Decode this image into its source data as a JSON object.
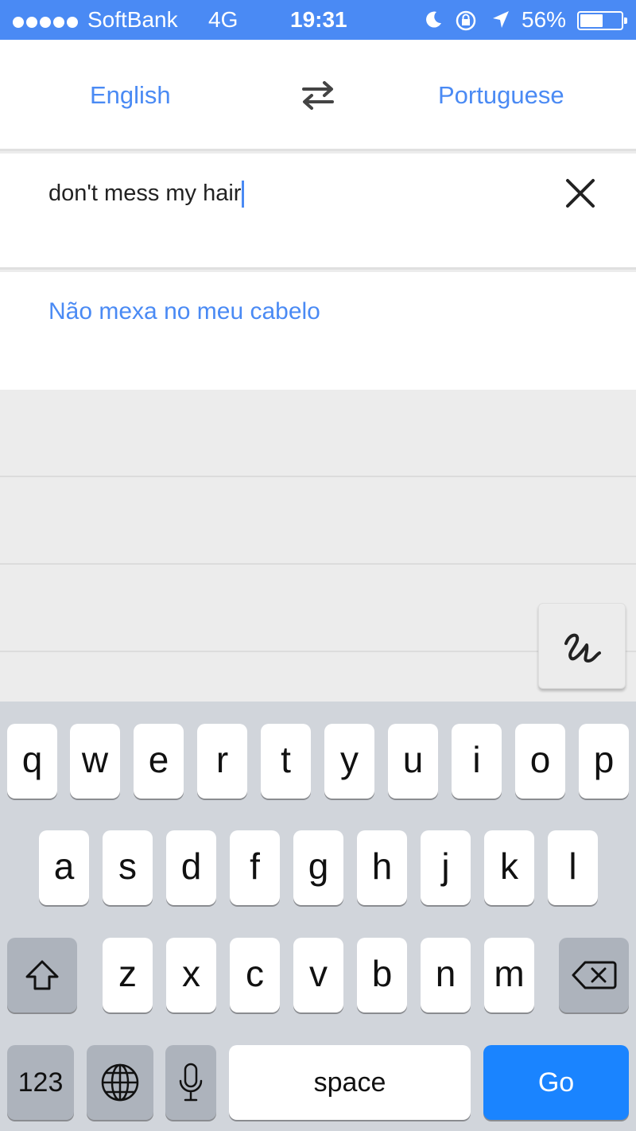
{
  "status_bar": {
    "carrier": "SoftBank",
    "network": "4G",
    "time": "19:31",
    "battery_percent": "56%",
    "battery_level": 0.56,
    "signal_dots": 5,
    "icons": [
      "moon-icon",
      "rotation-lock-icon",
      "location-arrow-icon",
      "battery-icon"
    ]
  },
  "language_bar": {
    "source_language": "English",
    "target_language": "Portuguese",
    "swap_icon": "swap-arrows-icon"
  },
  "input": {
    "text": "don't mess my hair",
    "clear_icon": "close-icon"
  },
  "translation": {
    "text": "Não mexa no meu cabelo"
  },
  "handwriting_button": {
    "icon": "handwriting-icon"
  },
  "keyboard": {
    "row1": [
      "q",
      "w",
      "e",
      "r",
      "t",
      "y",
      "u",
      "i",
      "o",
      "p"
    ],
    "row2": [
      "a",
      "s",
      "d",
      "f",
      "g",
      "h",
      "j",
      "k",
      "l"
    ],
    "row3": [
      "z",
      "x",
      "c",
      "v",
      "b",
      "n",
      "m"
    ],
    "numbers_label": "123",
    "space_label": "space",
    "go_label": "Go",
    "icons": [
      "shift-icon",
      "backspace-icon",
      "globe-icon",
      "microphone-icon"
    ]
  },
  "colors": {
    "accent": "#4a8af4",
    "go_key": "#1a84ff",
    "keyboard_bg": "#d1d5db"
  }
}
